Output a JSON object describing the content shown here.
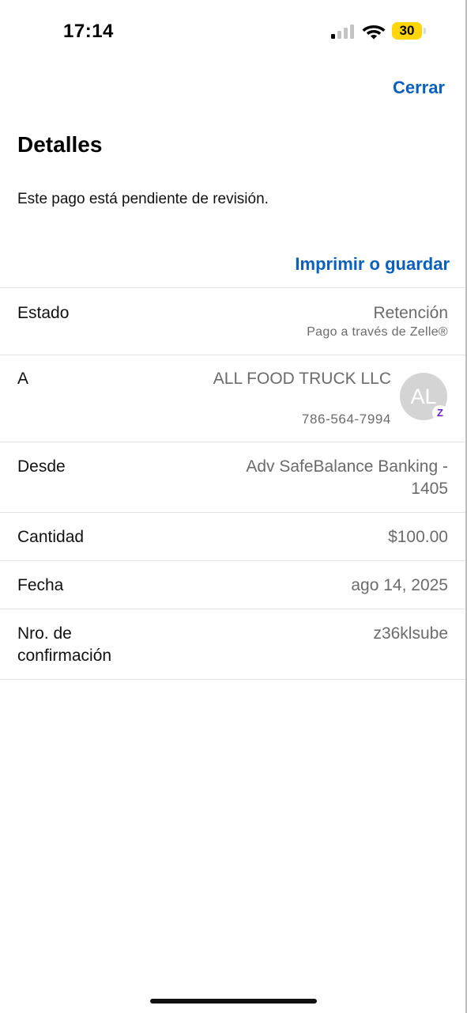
{
  "status_bar": {
    "time": "17:14",
    "battery": "30",
    "battery_level_percent": 30,
    "signal_icon": "cellular-signal-icon",
    "wifi_icon": "wifi-icon"
  },
  "header": {
    "close_label": "Cerrar",
    "title": "Detalles",
    "notice": "Este pago está pendiente de revisión.",
    "print_label": "Imprimir o guardar"
  },
  "details": {
    "estado": {
      "label": "Estado",
      "value": "Retención",
      "sub": "Pago a través de Zelle®"
    },
    "a": {
      "label": "A",
      "name": "ALL FOOD TRUCK LLC",
      "phone": "786-564-7994",
      "avatar_initials": "AL",
      "badge_icon": "zelle-icon"
    },
    "desde": {
      "label": "Desde",
      "value": "Adv SafeBalance Banking - 1405"
    },
    "cantidad": {
      "label": "Cantidad",
      "value": "$100.00"
    },
    "fecha": {
      "label": "Fecha",
      "value": "ago 14, 2025"
    },
    "confirmacion": {
      "label": "Nro. de confirmación",
      "value": "z36klsube"
    }
  },
  "colors": {
    "link": "#0a5fbf",
    "secondary_text": "#6b6b6b",
    "divider": "#e3e3e3",
    "zelle": "#6d1ed4",
    "battery": "#ffd60a"
  }
}
